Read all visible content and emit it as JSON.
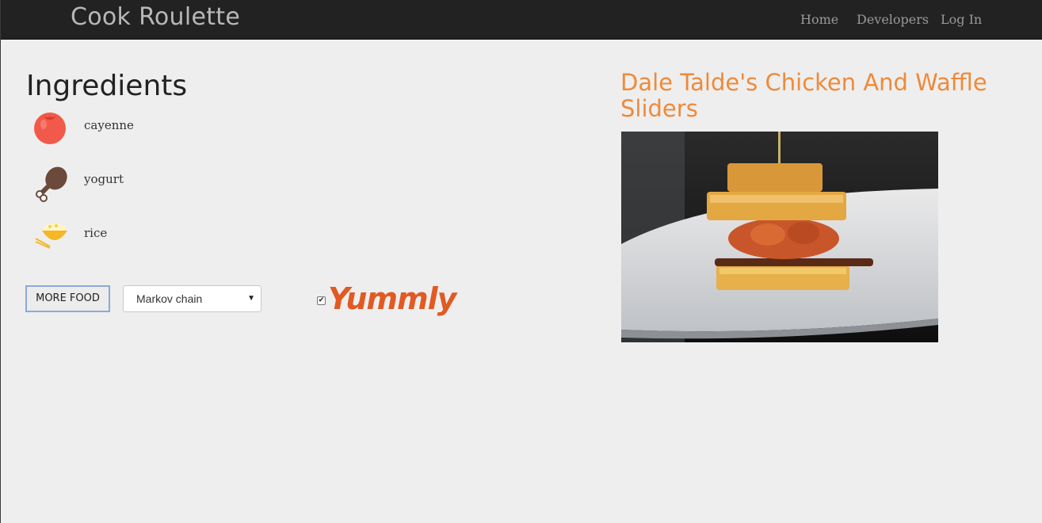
{
  "nav": {
    "brand": "Cook Roulette",
    "links": [
      "Home",
      "Developers",
      "Log In"
    ]
  },
  "ingredients": {
    "heading": "Ingredients",
    "items": [
      {
        "label": "cayenne",
        "icon": "tomato-icon"
      },
      {
        "label": "yogurt",
        "icon": "chicken-leg-icon"
      },
      {
        "label": "rice",
        "icon": "rice-bowl-icon"
      }
    ]
  },
  "controls": {
    "more_food_label": "MORE FOOD",
    "algorithm_selected": "Markov chain",
    "yummly_checked": true,
    "yummly_logo": "Yummly"
  },
  "recipe": {
    "title": "Dale Talde's Chicken And Waffle Sliders",
    "image": "chicken-waffle-slider-photo"
  },
  "colors": {
    "navbar": "#222222",
    "accent_title": "#ef8a3a",
    "yummly": "#e15a23"
  }
}
